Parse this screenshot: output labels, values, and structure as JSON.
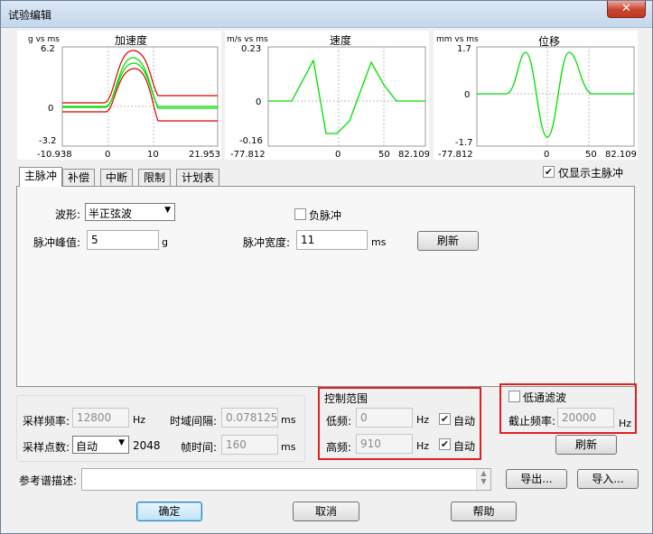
{
  "window": {
    "title": "试验编辑",
    "close_glyph": "✕"
  },
  "charts": [
    {
      "id": "accel",
      "title": "加速度",
      "units": "g vs ms",
      "y_ticks": [
        "6.2",
        "0",
        "-3.2"
      ],
      "x_ticks": [
        "-10.938",
        "0",
        "10",
        "21.953"
      ]
    },
    {
      "id": "velocity",
      "title": "速度",
      "units": "m/s vs ms",
      "y_ticks": [
        "0.23",
        "0",
        "-0.16"
      ],
      "x_ticks": [
        "-77.812",
        "0",
        "50",
        "82.109"
      ]
    },
    {
      "id": "displacement",
      "title": "位移",
      "units": "mm vs ms",
      "y_ticks": [
        "1.7",
        "0",
        "-1.7"
      ],
      "x_ticks": [
        "-77.812",
        "0",
        "50",
        "82.109"
      ]
    }
  ],
  "show_main_pulse_only": {
    "label": "仅显示主脉冲",
    "checked": true
  },
  "tabs": [
    {
      "label": "主脉冲",
      "active": true
    },
    {
      "label": "补偿",
      "active": false
    },
    {
      "label": "中断",
      "active": false
    },
    {
      "label": "限制",
      "active": false
    },
    {
      "label": "计划表",
      "active": false
    }
  ],
  "main_pulse": {
    "waveform_label": "波形:",
    "waveform_value": "半正弦波",
    "negative_pulse_label": "负脉冲",
    "negative_pulse_checked": false,
    "peak_label": "脉冲峰值:",
    "peak_value": "5",
    "peak_unit": "g",
    "width_label": "脉冲宽度:",
    "width_value": "11",
    "width_unit": "ms",
    "refresh_label": "刷新"
  },
  "sampling": {
    "rate_label": "采样频率:",
    "rate_value": "12800",
    "rate_unit": "Hz",
    "interval_label": "时域间隔:",
    "interval_value": "0.078125",
    "interval_unit": "ms",
    "points_label": "采样点数:",
    "points_select": "自动",
    "points_value": "2048",
    "frame_label": "帧时间:",
    "frame_value": "160",
    "frame_unit": "ms"
  },
  "control_range": {
    "title": "控制范围",
    "low_label": "低频:",
    "low_value": "0",
    "low_unit": "Hz",
    "low_auto_label": "自动",
    "low_auto_checked": true,
    "high_label": "高频:",
    "high_value": "910",
    "high_unit": "Hz",
    "high_auto_label": "自动",
    "high_auto_checked": true
  },
  "lowpass": {
    "title": "低通滤波",
    "checked": false,
    "cutoff_label": "截止频率:",
    "cutoff_value": "20000",
    "cutoff_unit": "Hz",
    "refresh_label": "刷新"
  },
  "reference": {
    "label": "参考谱描述:",
    "value": ""
  },
  "buttons": {
    "export": "导出...",
    "import": "导入...",
    "ok": "确定",
    "cancel": "取消",
    "help": "帮助"
  },
  "colors": {
    "trace_green": "#00dd00",
    "limit_red": "#dd0000",
    "highlight_red": "#e02020"
  }
}
